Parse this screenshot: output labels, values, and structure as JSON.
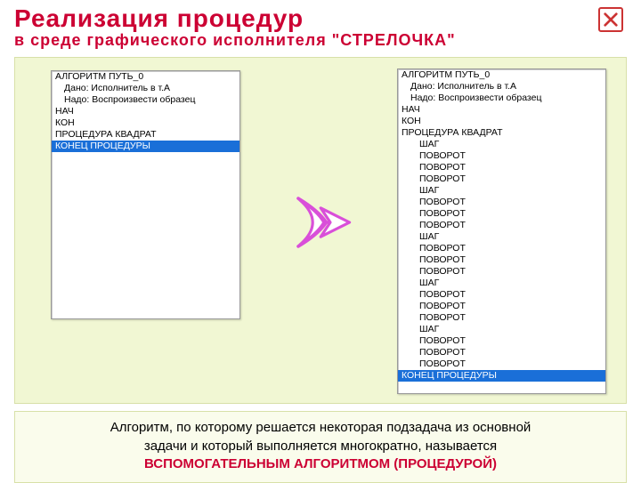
{
  "header": {
    "title": "Реализация  процедур",
    "subtitle": "в  среде  графического  исполнителя  \"СТРЕЛОЧКА\""
  },
  "close_icon": "close",
  "left_code": [
    {
      "t": "АЛГОРИТМ ПУТЬ_0",
      "lv": 0,
      "sel": false
    },
    {
      "t": "Дано: Исполнитель в т.А",
      "lv": 1,
      "sel": false
    },
    {
      "t": "Надо: Воспроизвести образец",
      "lv": 1,
      "sel": false
    },
    {
      "t": "НАЧ",
      "lv": 0,
      "sel": false
    },
    {
      "t": "КОН",
      "lv": 0,
      "sel": false
    },
    {
      "t": "ПРОЦЕДУРА КВАДРАТ",
      "lv": 0,
      "sel": false
    },
    {
      "t": "КОНЕЦ ПРОЦЕДУРЫ",
      "lv": 0,
      "sel": true
    }
  ],
  "right_code": [
    {
      "t": "АЛГОРИТМ ПУТЬ_0",
      "lv": 0,
      "sel": false
    },
    {
      "t": "Дано: Исполнитель в т.А",
      "lv": 1,
      "sel": false
    },
    {
      "t": "Надо: Воспроизвести образец",
      "lv": 1,
      "sel": false
    },
    {
      "t": "НАЧ",
      "lv": 0,
      "sel": false
    },
    {
      "t": "КОН",
      "lv": 0,
      "sel": false
    },
    {
      "t": "ПРОЦЕДУРА КВАДРАТ",
      "lv": 0,
      "sel": false
    },
    {
      "t": "ШАГ",
      "lv": 2,
      "sel": false
    },
    {
      "t": "ПОВОРОТ",
      "lv": 2,
      "sel": false
    },
    {
      "t": "ПОВОРОТ",
      "lv": 2,
      "sel": false
    },
    {
      "t": "ПОВОРОТ",
      "lv": 2,
      "sel": false
    },
    {
      "t": "ШАГ",
      "lv": 2,
      "sel": false
    },
    {
      "t": "ПОВОРОТ",
      "lv": 2,
      "sel": false
    },
    {
      "t": "ПОВОРОТ",
      "lv": 2,
      "sel": false
    },
    {
      "t": "ПОВОРОТ",
      "lv": 2,
      "sel": false
    },
    {
      "t": "ШАГ",
      "lv": 2,
      "sel": false
    },
    {
      "t": "ПОВОРОТ",
      "lv": 2,
      "sel": false
    },
    {
      "t": "ПОВОРОТ",
      "lv": 2,
      "sel": false
    },
    {
      "t": "ПОВОРОТ",
      "lv": 2,
      "sel": false
    },
    {
      "t": "ШАГ",
      "lv": 2,
      "sel": false
    },
    {
      "t": "ПОВОРОТ",
      "lv": 2,
      "sel": false
    },
    {
      "t": "ПОВОРОТ",
      "lv": 2,
      "sel": false
    },
    {
      "t": "ПОВОРОТ",
      "lv": 2,
      "sel": false
    },
    {
      "t": "ШАГ",
      "lv": 2,
      "sel": false
    },
    {
      "t": "ПОВОРОТ",
      "lv": 2,
      "sel": false
    },
    {
      "t": "ПОВОРОТ",
      "lv": 2,
      "sel": false
    },
    {
      "t": "ПОВОРОТ",
      "lv": 2,
      "sel": false
    },
    {
      "t": "КОНЕЦ ПРОЦЕДУРЫ",
      "lv": 0,
      "sel": true
    }
  ],
  "footer": {
    "line1": "Алгоритм, по которому решается некоторая подзадача из основной",
    "line2": "задачи и который выполняется многократно, называется",
    "em": "ВСПОМОГАТЕЛЬНЫМ АЛГОРИТМОМ (ПРОЦЕДУРОЙ)"
  }
}
